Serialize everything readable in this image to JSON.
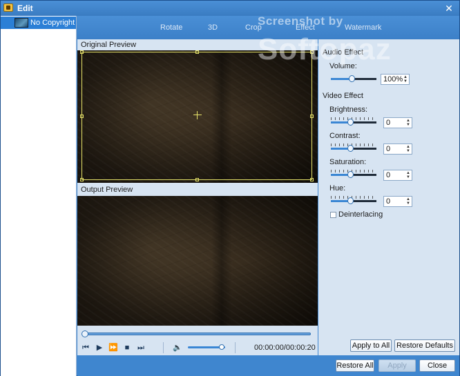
{
  "window": {
    "title": "Edit"
  },
  "tabs": [
    {
      "label": "Rotate"
    },
    {
      "label": "3D"
    },
    {
      "label": "Crop"
    },
    {
      "label": "Effect"
    },
    {
      "label": "Watermark"
    }
  ],
  "sidebar": {
    "items": [
      {
        "label": "No Copyright ..."
      }
    ]
  },
  "preview": {
    "original_label": "Original Preview",
    "output_label": "Output Preview",
    "timecode": "00:00:00/00:00:20",
    "seek_progress": 0.0,
    "volume_level": 0.9
  },
  "audio_effect": {
    "title": "Audio Effect",
    "volume_label": "Volume:",
    "volume_value": "100%",
    "volume_level": 0.45
  },
  "video_effect": {
    "title": "Video Effect",
    "brightness_label": "Brightness:",
    "brightness_value": "0",
    "contrast_label": "Contrast:",
    "contrast_value": "0",
    "saturation_label": "Saturation:",
    "saturation_value": "0",
    "hue_label": "Hue:",
    "hue_value": "0",
    "deinterlacing_label": "Deinterlacing"
  },
  "buttons": {
    "apply_to_all": "Apply to All",
    "restore_defaults": "Restore Defaults",
    "restore_all": "Restore All",
    "apply": "Apply",
    "close": "Close"
  },
  "watermark": {
    "line1": "Screenshot by",
    "line2": "Softopaz"
  },
  "colors": {
    "accent": "#3f86cf",
    "selection": "#2b7fd6",
    "crop_frame": "#e8e46a"
  }
}
